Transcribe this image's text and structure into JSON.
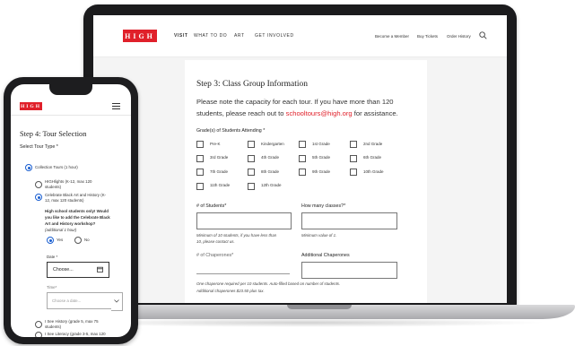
{
  "site": {
    "logo": "HIGH"
  },
  "nav": {
    "links": [
      "VISIT",
      "WHAT TO DO",
      "ART",
      "GET INVOLVED"
    ],
    "utility": [
      "Become a Member",
      "Buy Tickets",
      "Order History"
    ]
  },
  "form": {
    "step_title": "Step 3: Class Group Information",
    "notice_line1": "Please note the capacity for each tour. If you have more than 120",
    "notice_line2_start": "students, please reach out to ",
    "notice_email": "schooltours@high.org",
    "notice_line2_end": " for assistance.",
    "grades_label": "Grade(s) of Students Attending *",
    "grades": [
      "Pre-K",
      "Kindergarten",
      "1st Grade",
      "2nd Grade",
      "3rd Grade",
      "4th Grade",
      "5th Grade",
      "6th Grade",
      "7th Grade",
      "8th Grade",
      "9th Grade",
      "10th Grade",
      "11th Grade",
      "12th Grade"
    ],
    "students_label": "# of Students*",
    "students_help_line1": "Minimum of 10 students, if you have less than",
    "students_help_line2": "10, please contact us.",
    "classes_label": "How many classes?*",
    "classes_help": "Minimum value of 1.",
    "chaperones_label": "# of Chaperones*",
    "additional_label": "Additional Chaperones",
    "chaperone_help_line1": "One chaperone required per 10 students. Auto-filled based on number of students.",
    "chaperone_help_line2": "Additional chaperones $23.50 plus tax."
  },
  "phone": {
    "logo": "HIGH",
    "step_title": "Step 4: Tour Selection",
    "tour_type_label": "Select Tour Type *",
    "tour_collection": "Collection Tours (1 hour)",
    "tour_highlights_l1": "HIGHlights (K-12, max 120",
    "tour_highlights_l2": "students)",
    "tour_celebrate_l1": "Celebrate Black Art and History (K-",
    "tour_celebrate_l2": "12, max 120 students)",
    "workshop_l1": "High school students only! Would",
    "workshop_l2": "you like to add the Celebrate Black",
    "workshop_l3": "Art and History workshop?",
    "workshop_l4": "(additional 1 hour)",
    "yes": "Yes",
    "no": "No",
    "date_label": "Date *",
    "date_button": "Choose...",
    "time_label": "Time*",
    "time_placeholder": "Choose a date...",
    "tour_history_l1": "I See History (grade 5, max 75",
    "tour_history_l2": "students)",
    "tour_literacy": "I See Literacy (grade 3-5, max 120"
  },
  "colors": {
    "brand_red": "#e0202a",
    "radio_blue": "#1a5fd1"
  }
}
